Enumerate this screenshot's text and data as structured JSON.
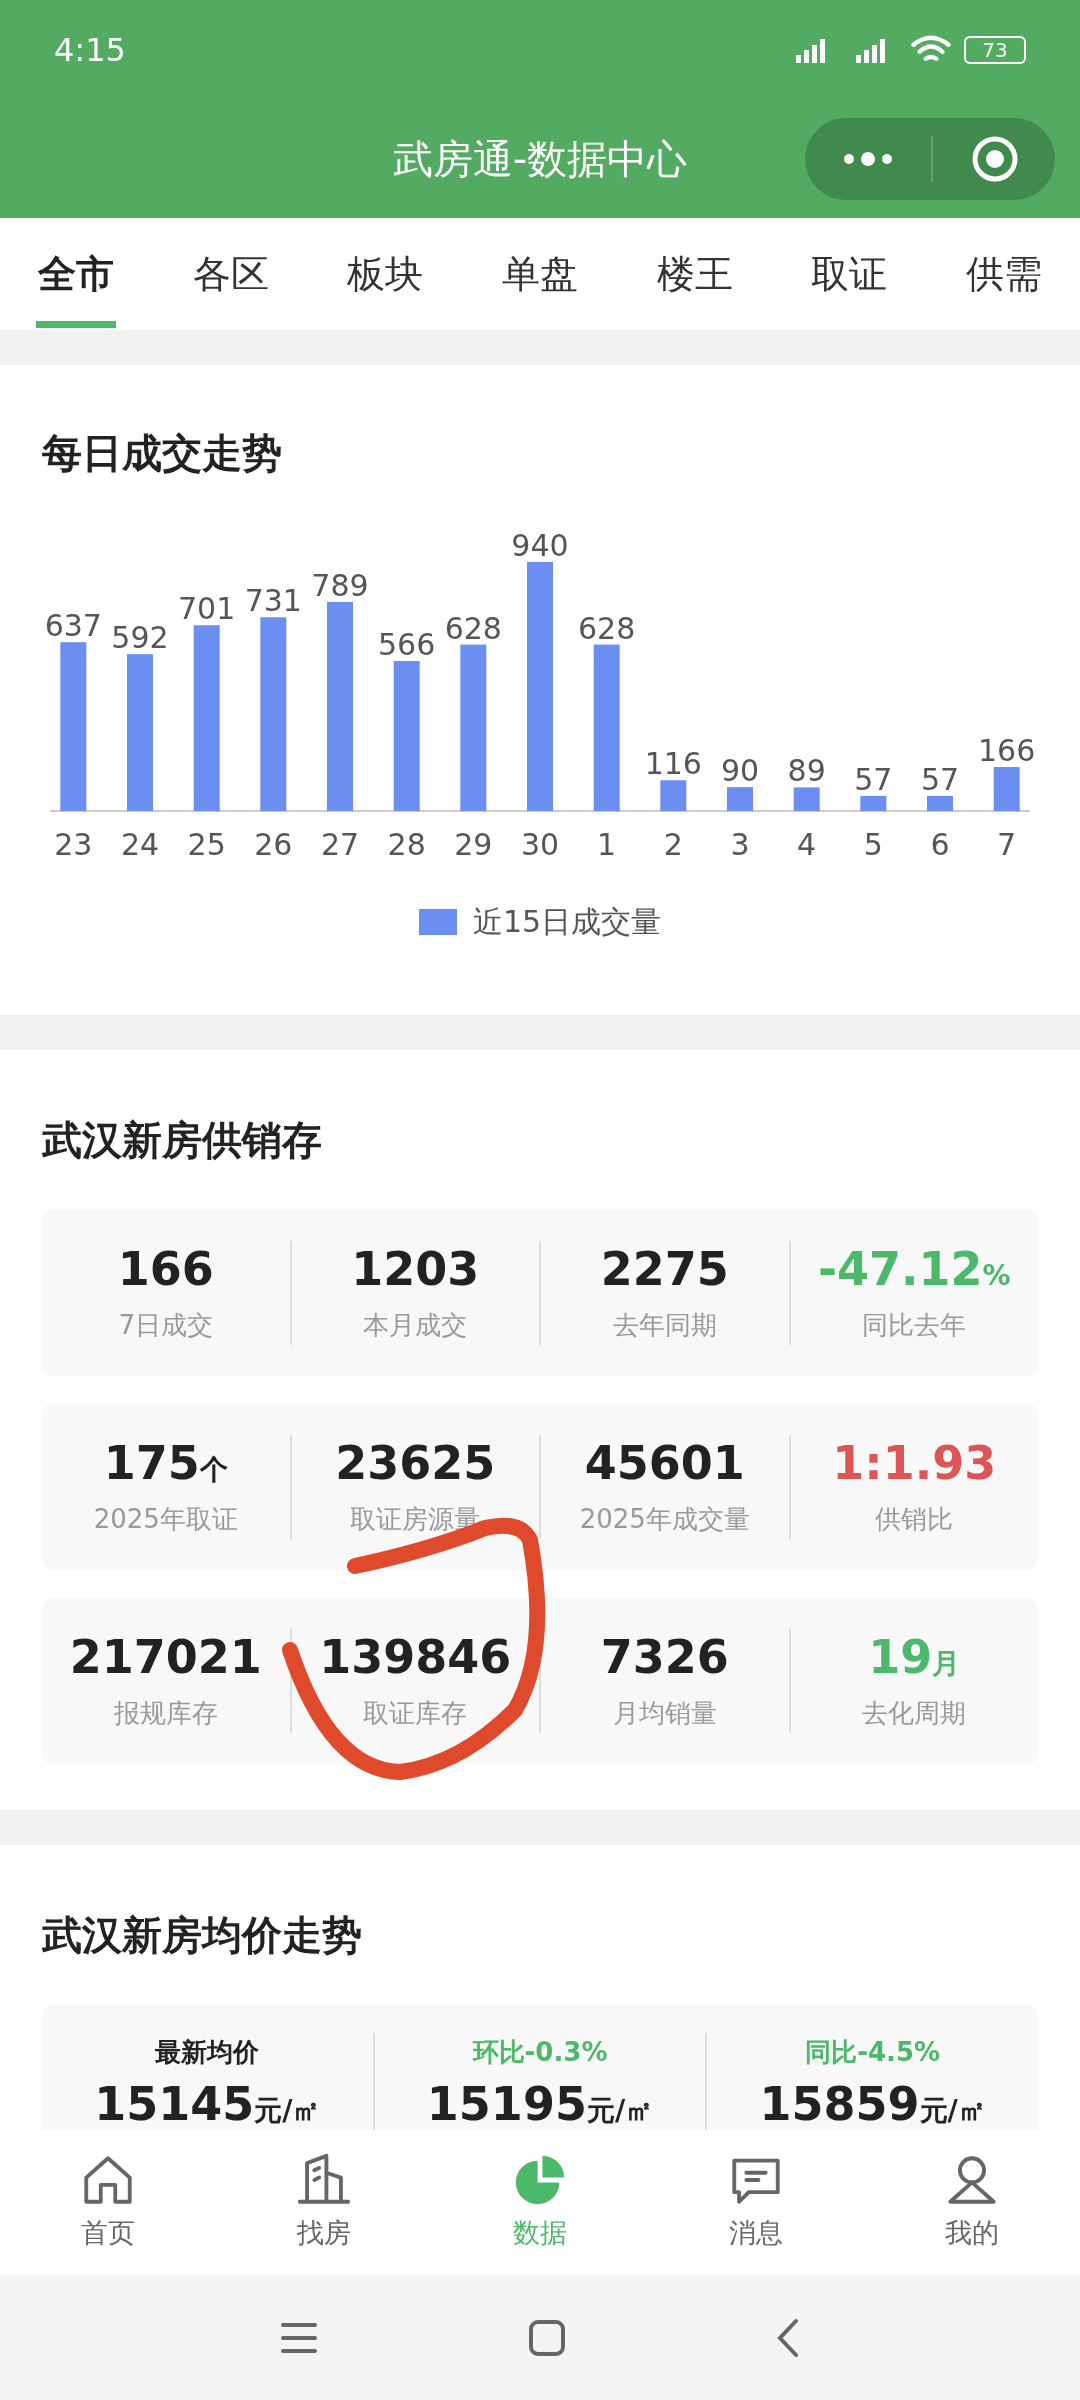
{
  "status_bar": {
    "time": "4:15",
    "battery": "73"
  },
  "header": {
    "title": "武房通-数据中心"
  },
  "tabs": [
    {
      "label": "全市",
      "selected": true
    },
    {
      "label": "各区",
      "selected": false
    },
    {
      "label": "板块",
      "selected": false
    },
    {
      "label": "单盘",
      "selected": false
    },
    {
      "label": "楼王",
      "selected": false
    },
    {
      "label": "取证",
      "selected": false
    },
    {
      "label": "供需",
      "selected": false
    }
  ],
  "daily_trend": {
    "title": "每日成交走势",
    "chart_data": {
      "type": "bar",
      "categories": [
        "23",
        "24",
        "25",
        "26",
        "27",
        "28",
        "29",
        "30",
        "1",
        "2",
        "3",
        "4",
        "5",
        "6",
        "7"
      ],
      "series": [
        {
          "name": "近15日成交量",
          "color": "#6b8ff0",
          "values": [
            637,
            592,
            701,
            731,
            789,
            566,
            628,
            940,
            628,
            116,
            90,
            89,
            57,
            57,
            166
          ]
        }
      ],
      "data_labels": true
    }
  },
  "supply": {
    "title": "武汉新房供销存",
    "rows": [
      [
        {
          "value": "166",
          "label": "7日成交",
          "color": "#222222"
        },
        {
          "value": "1203",
          "label": "本月成交",
          "color": "#222222"
        },
        {
          "value": "2275",
          "label": "去年同期",
          "color": "#222222"
        },
        {
          "value": "-47.12",
          "unit": "%",
          "label": "同比去年",
          "color": "#4cb86a"
        }
      ],
      [
        {
          "value": "175",
          "unit": "个",
          "label": "2025年取证",
          "color": "#222222"
        },
        {
          "value": "23625",
          "label": "取证房源量",
          "color": "#222222"
        },
        {
          "value": "45601",
          "label": "2025年成交量",
          "color": "#222222"
        },
        {
          "value": "1:1.93",
          "label": "供销比",
          "color": "#dd5555"
        }
      ],
      [
        {
          "value": "217021",
          "label": "报规库存",
          "color": "#222222"
        },
        {
          "value": "139846",
          "label": "取证库存",
          "color": "#222222"
        },
        {
          "value": "7326",
          "label": "月均销量",
          "color": "#222222"
        },
        {
          "value": "19",
          "unit": "月",
          "label": "去化周期",
          "color": "#4cb86a"
        }
      ]
    ]
  },
  "price": {
    "title": "武汉新房均价走势",
    "items": [
      {
        "label": "最新均价",
        "color": "#222222",
        "value": "15145",
        "unit": "元/㎡"
      },
      {
        "label": "环比-0.3%",
        "color": "#4cb86a",
        "value": "15195",
        "unit": "元/㎡"
      },
      {
        "label": "同比-4.5%",
        "color": "#4cb86a",
        "value": "15859",
        "unit": "元/㎡"
      }
    ]
  },
  "bottom_nav": [
    {
      "label": "首页",
      "kind": "home",
      "selected": false
    },
    {
      "label": "找房",
      "kind": "building",
      "selected": false
    },
    {
      "label": "数据",
      "kind": "pie",
      "selected": true
    },
    {
      "label": "消息",
      "kind": "message",
      "selected": false
    },
    {
      "label": "我的",
      "kind": "user",
      "selected": false
    }
  ]
}
